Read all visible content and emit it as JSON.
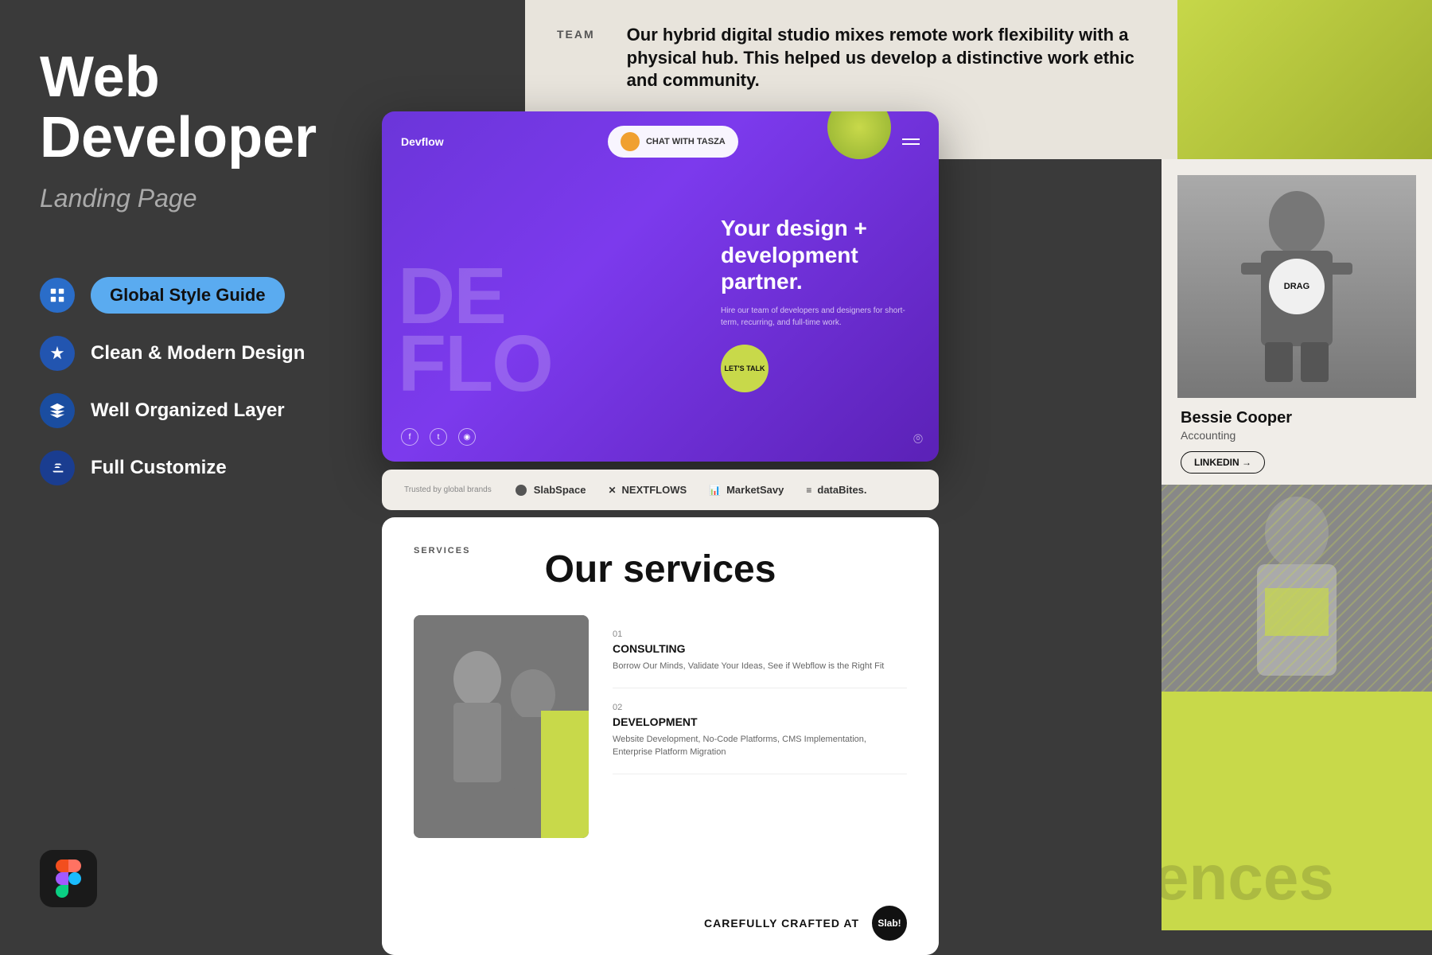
{
  "left": {
    "title_line1": "Web",
    "title_line2": "Developer",
    "subtitle": "Landing Page",
    "features": [
      {
        "id": "global-style",
        "label": "Global Style Guide",
        "active": true,
        "icon": "grid"
      },
      {
        "id": "clean-modern",
        "label": "Clean & Modern Design",
        "active": false,
        "icon": "sparkle"
      },
      {
        "id": "well-organized",
        "label": "Well Organized Layer",
        "active": false,
        "icon": "layers"
      },
      {
        "id": "full-customize",
        "label": "Full Customize",
        "active": false,
        "icon": "crop"
      }
    ],
    "figma_label": "Figma"
  },
  "team_section": {
    "label": "TEAM",
    "description": "Our hybrid digital studio mixes remote work flexibility with a physical hub. This helped us develop a distinctive work ethic and community."
  },
  "hero": {
    "logo": "Devflow",
    "chat_label": "CHAT WITH TASZA",
    "big_text_line1": "DE",
    "big_text_line2": "FLO",
    "headline": "Your design + development partner.",
    "sub_text": "Hire our team of developers and designers for short-term, recurring, and full-time work.",
    "cta": "LET'S TALK",
    "social": [
      "f",
      "t",
      "📷"
    ]
  },
  "brands": {
    "label": "Trusted by global brands",
    "items": [
      "SlabSpace",
      "NEXTFLOWS",
      "MarketSavy",
      "dataBites."
    ]
  },
  "services": {
    "section_label": "SERVICES",
    "title": "Our services",
    "items": [
      {
        "num": "01",
        "name": "CONSULTING",
        "desc": "Borrow Our Minds, Validate Your Ideas, See if Webflow is the Right Fit"
      },
      {
        "num": "02",
        "name": "DEVELOPMENT",
        "desc": "Website Development, No-Code Platforms, CMS Implementation, Enterprise Platform Migration"
      }
    ]
  },
  "people": [
    {
      "name": "Bessie Cooper",
      "role": "Accounting",
      "linkedin_label": "LINKEDIN →"
    }
  ],
  "crafted": {
    "text": "CAREFULLY CRAFTED AT",
    "logo": "Slab!"
  },
  "bottom": {
    "text": "ences"
  }
}
